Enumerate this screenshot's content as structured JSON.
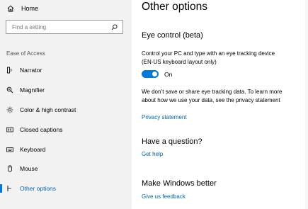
{
  "sidebar": {
    "home_label": "Home",
    "search_placeholder": "Find a setting",
    "section_title": "Ease of Access",
    "items": [
      {
        "label": "Narrator",
        "icon": "narrator-icon"
      },
      {
        "label": "Magnifier",
        "icon": "magnifier-icon"
      },
      {
        "label": "Color & high contrast",
        "icon": "brightness-icon"
      },
      {
        "label": "Closed captions",
        "icon": "closed-captions-icon"
      },
      {
        "label": "Keyboard",
        "icon": "keyboard-icon"
      },
      {
        "label": "Mouse",
        "icon": "mouse-icon"
      },
      {
        "label": "Other options",
        "icon": "other-options-icon",
        "active": true
      }
    ]
  },
  "main": {
    "title": "Other options",
    "eye_control": {
      "heading": "Eye control (beta)",
      "description_lines": [
        "Control your PC and type with an eye tracking device",
        "(EN-US keyboard layout only)"
      ],
      "toggle_state": "On",
      "toggle_on": true,
      "privacy_lines": [
        "We don’t save or share eye tracking data. To learn more",
        "about how we use your data, see the privacy statement"
      ],
      "privacy_link": "Privacy statement"
    },
    "question": {
      "heading": "Have a question?",
      "link": "Get help"
    },
    "better": {
      "heading": "Make Windows better",
      "link": "Give us feedback"
    }
  },
  "colors": {
    "accent": "#0078d7",
    "link": "#0063b1",
    "sidebar_bg": "#f2f2f2"
  }
}
